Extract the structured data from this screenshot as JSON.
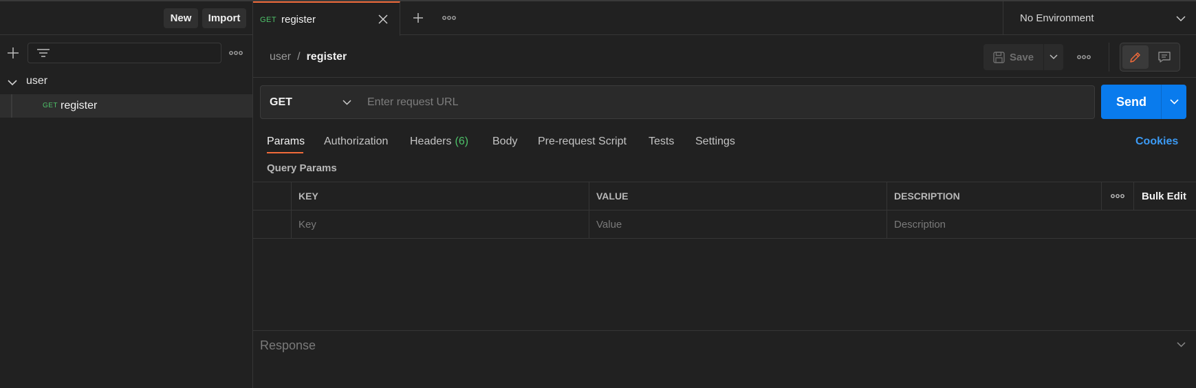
{
  "sidebar": {
    "new_label": "New",
    "import_label": "Import",
    "tree": [
      {
        "label": "user",
        "expanded": true
      },
      {
        "method": "GET",
        "label": "register"
      }
    ]
  },
  "tabs": {
    "active": {
      "method": "GET",
      "label": "register"
    }
  },
  "environment": {
    "selected": "No Environment"
  },
  "breadcrumb": {
    "parent": "user",
    "separator": "/",
    "current": "register"
  },
  "toolbar": {
    "save_label": "Save"
  },
  "request": {
    "method": "GET",
    "url_placeholder": "Enter request URL",
    "send_label": "Send"
  },
  "request_tabs": {
    "items": [
      "Params",
      "Authorization",
      "Headers",
      "Body",
      "Pre-request Script",
      "Tests",
      "Settings"
    ],
    "headers_count": "(6)",
    "active": "Params",
    "cookies_label": "Cookies"
  },
  "params": {
    "title": "Query Params",
    "columns": [
      "KEY",
      "VALUE",
      "DESCRIPTION"
    ],
    "bulk_edit_label": "Bulk Edit",
    "placeholders": [
      "Key",
      "Value",
      "Description"
    ]
  },
  "response": {
    "title": "Response"
  },
  "colors": {
    "accent": "#f26b3a",
    "send": "#097bed",
    "get_method": "#4ec36a",
    "link": "#3c9bf5"
  }
}
